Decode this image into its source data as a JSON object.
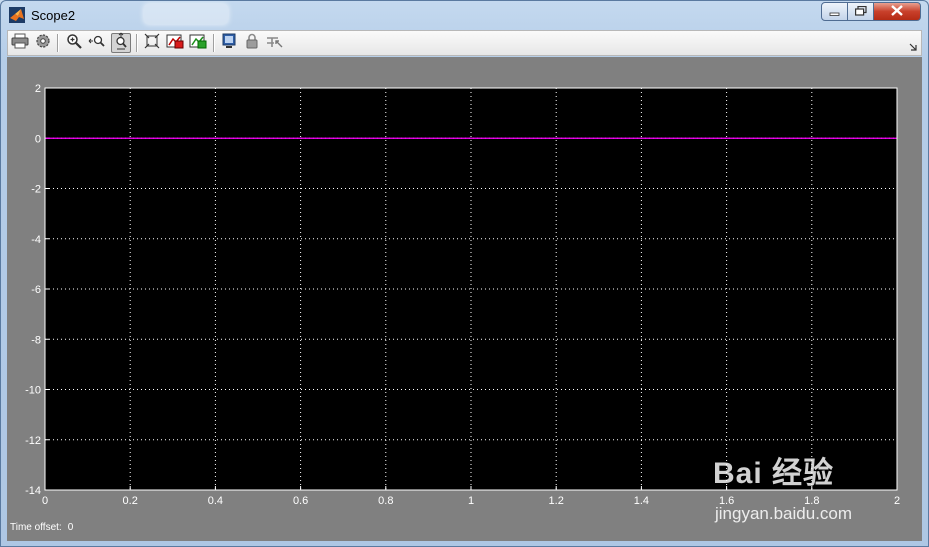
{
  "window": {
    "title": "Scope2"
  },
  "toolbar": {
    "buttons": [
      {
        "name": "print-button",
        "icon": "printer-icon"
      },
      {
        "name": "parameters-button",
        "icon": "gear-icon"
      },
      {
        "name": "zoom-in-button",
        "icon": "zoom-in-icon"
      },
      {
        "name": "zoom-x-button",
        "icon": "zoom-x-icon"
      },
      {
        "name": "zoom-y-button",
        "icon": "zoom-y-icon",
        "pressed": true
      },
      {
        "name": "autoscale-button",
        "icon": "autoscale-icon"
      },
      {
        "name": "save-axes-button",
        "icon": "save-axes-icon"
      },
      {
        "name": "restore-axes-button",
        "icon": "restore-axes-icon"
      },
      {
        "name": "floating-scope-button",
        "icon": "floating-scope-icon"
      },
      {
        "name": "lock-axes-button",
        "icon": "lock-icon"
      },
      {
        "name": "signal-selection-button",
        "icon": "signal-selection-icon"
      }
    ]
  },
  "status": {
    "time_offset_label": "Time offset:",
    "time_offset_value": "0"
  },
  "watermark": {
    "logo": "Bai 经验",
    "url": "jingyan.baidu.com"
  },
  "colors": {
    "plot_bg": "#000000",
    "frame_bg": "#808080",
    "grid": "#ffffff",
    "signal": "#ff00ff"
  },
  "chart_data": {
    "type": "line",
    "x": [
      0,
      2
    ],
    "series": [
      {
        "values": [
          0,
          0
        ]
      }
    ],
    "xlim": [
      0,
      2
    ],
    "ylim": [
      -14,
      2
    ],
    "xticks": [
      "0",
      "0.2",
      "0.4",
      "0.6",
      "0.8",
      "1",
      "1.2",
      "1.4",
      "1.6",
      "1.8",
      "2"
    ],
    "yticks": [
      "2",
      "0",
      "-2",
      "-4",
      "-6",
      "-8",
      "-10",
      "-12",
      "-14"
    ],
    "grid": true
  }
}
